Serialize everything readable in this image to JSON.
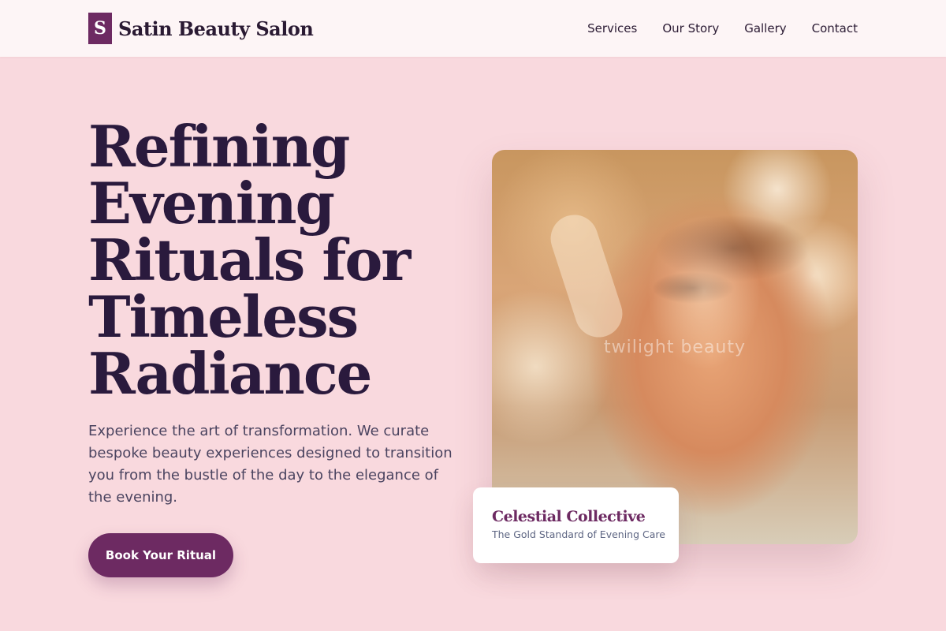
{
  "brand": {
    "logo_letter": "S",
    "name": "Satin Beauty Salon",
    "accent_color": "#6d2a62"
  },
  "nav": {
    "items": [
      {
        "label": "Services"
      },
      {
        "label": "Our Story"
      },
      {
        "label": "Gallery"
      },
      {
        "label": "Contact"
      }
    ]
  },
  "hero": {
    "title": "Refining Evening Rituals for Timeless Radiance",
    "description": "Experience the art of transformation. We curate bespoke beauty experiences designed to transition you from the bustle of the day to the elegance of the evening.",
    "cta_label": "Book Your Ritual"
  },
  "feature": {
    "image_watermark": "twilight beauty",
    "card_title": "Celestial Collective",
    "card_subtitle": "The Gold Standard of Evening Care"
  },
  "colors": {
    "background": "#f9d9de",
    "header_background": "#fdf5f6",
    "heading_text": "#2a1a3d",
    "body_text": "#4b4460"
  }
}
